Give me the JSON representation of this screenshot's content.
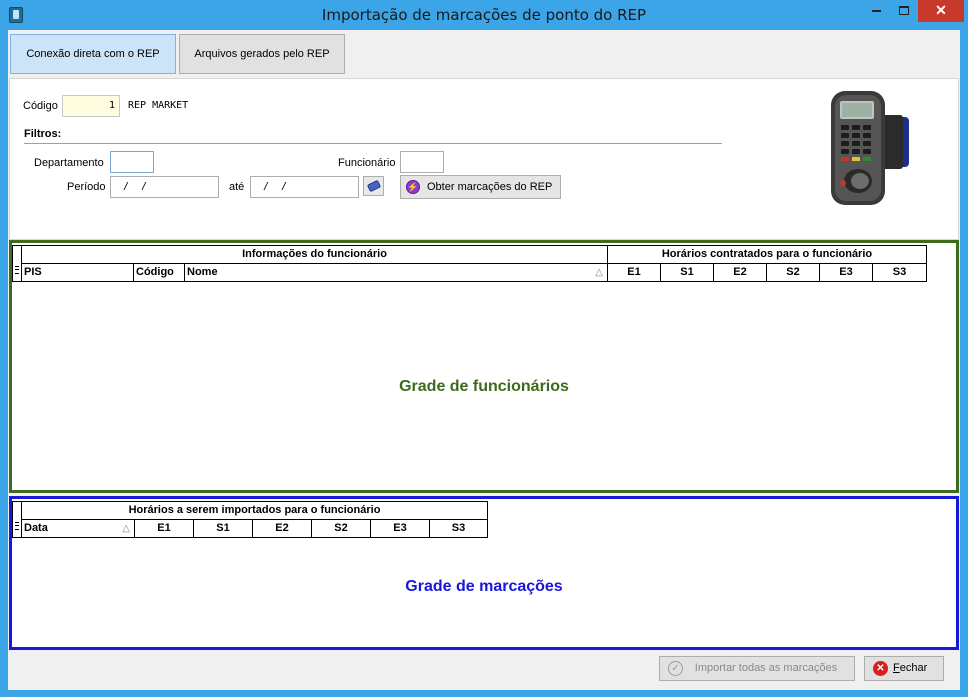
{
  "window": {
    "title": "Importação de marcações de ponto do REP",
    "minimize_label": "",
    "maximize_label": "",
    "close_label": "✕"
  },
  "tabs": [
    {
      "label": "Conexão direta com o REP",
      "active": true
    },
    {
      "label": "Arquivos gerados pelo REP",
      "active": false
    }
  ],
  "form": {
    "codigo_label": "Código",
    "codigo_value": "1",
    "rep_name": "REP MARKET",
    "filtros_label": "Filtros:",
    "departamento_label": "Departamento",
    "departamento_value": "",
    "funcionario_label": "Funcionário",
    "funcionario_value": "",
    "periodo_label": "Período",
    "periodo_start": "/ /",
    "ate_label": "até",
    "periodo_end": "/ /",
    "obter_button": "Obter marcações do REP"
  },
  "grid_funcionarios": {
    "group_info": "Informações do funcionário",
    "group_horarios": "Horários contratados para o funcionário",
    "columns": [
      "PIS",
      "Código",
      "Nome",
      "E1",
      "S1",
      "E2",
      "S2",
      "E3",
      "S3"
    ],
    "caption": "Grade de funcionários",
    "border_color": "#3e6a1e"
  },
  "grid_marcacoes": {
    "group_horarios": "Horários a serem importados para o funcionário",
    "columns": [
      "Data",
      "E1",
      "S1",
      "E2",
      "S2",
      "E3",
      "S3"
    ],
    "caption": "Grade de marcações",
    "border_color": "#1818d8"
  },
  "footer": {
    "importar_button": "Importar todas as marcações",
    "fechar_prefix": "F",
    "fechar_rest": "echar"
  },
  "icons": [
    "app-icon",
    "eraser-icon",
    "lightning-icon",
    "rep-device-image",
    "check-icon",
    "close-x-icon"
  ]
}
